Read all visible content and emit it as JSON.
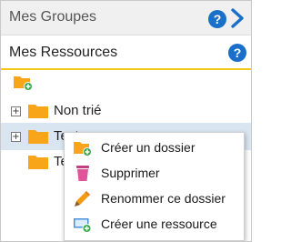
{
  "groups": {
    "title": "Mes Groupes",
    "help_icon": "question-icon",
    "next_icon": "chevron-right-icon"
  },
  "resources": {
    "title": "Mes Ressources",
    "help_icon": "question-icon",
    "add_folder_icon": "folder-add-icon"
  },
  "tree": {
    "nodes": [
      {
        "label": "Non trié",
        "expandable": true,
        "expander": "+"
      },
      {
        "label": "Test",
        "expandable": true,
        "expander": "+",
        "selected": true
      },
      {
        "label": "Te",
        "expandable": false
      }
    ]
  },
  "context_menu": {
    "items": [
      {
        "label": "Créer un dossier",
        "icon": "folder-add-icon"
      },
      {
        "label": "Supprimer",
        "icon": "trash-icon"
      },
      {
        "label": "Renommer ce dossier",
        "icon": "pencil-icon"
      },
      {
        "label": "Créer une ressource",
        "icon": "resource-add-icon"
      }
    ]
  },
  "colors": {
    "accent": "#f5c61a",
    "folder": "#f9a51a",
    "help": "#1a6fc9",
    "selected_row": "#d9e6f2",
    "trash": "#e0559a",
    "add": "#3aa64a"
  }
}
